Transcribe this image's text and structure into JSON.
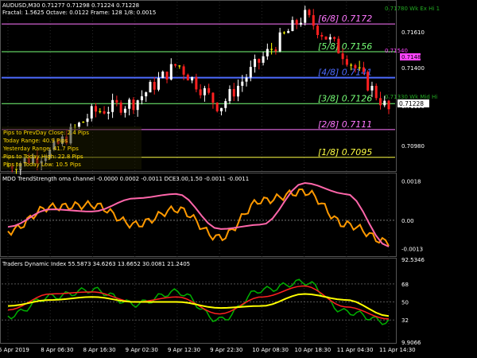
{
  "window_title": "AUDUSD,M30  0.71277 0.71298 0.71224 0.71228",
  "info_line": "Fractal: 1.5625   Octave: 0.0122   Frame: 128   1/8: 0.0015",
  "price_panel": {
    "y_ticks": [
      "0.71610",
      "0.71400",
      "0.71190",
      "0.70980"
    ],
    "current_price": "0.71228",
    "murrey_levels": [
      {
        "label": "[6/8]  0.7172",
        "value": 0.7172,
        "color": "#ff77ff"
      },
      {
        "label": "[5/8]  0.7156",
        "value": 0.7156,
        "color": "#77ff77"
      },
      {
        "label": "[4/8]  0.7141",
        "value": 0.7141,
        "color": "#4d6bff"
      },
      {
        "label": "[3/8]  0.7126",
        "value": 0.7126,
        "color": "#77ff77"
      },
      {
        "label": "[2/8]  0.7111",
        "value": 0.7111,
        "color": "#ff77ff"
      },
      {
        "label": "[1/8]  0.7095",
        "value": 0.7095,
        "color": "#ffff44"
      }
    ],
    "right_labels": [
      {
        "text": "0.71780  Wk Ex Hi 1",
        "color": "#22aa22"
      },
      {
        "text": "0.71540",
        "color": "#ff44ff"
      },
      {
        "text": "0.71480",
        "color": "#ff44ff"
      },
      {
        "text": "0.71330  Wk Mid Hi",
        "color": "#22aa22"
      }
    ],
    "overlay_text": [
      "Pips to PrevDay Close: 2.4 Pips",
      "Today Range: 40.9 Pips",
      "Yesterday Range: 41.7 Pips",
      "Pips to Today High: 22.8 Pips",
      "Pips to Today Low: 10.5 Pips"
    ]
  },
  "osc_panel": {
    "title": "MDO TrendStrength oma channel -0.0000 0.0002 -0.0011  DCE3.00,1.50 -0.0011 -0.0011",
    "y_ticks": [
      "0.0018",
      "0.00",
      "-0.0013"
    ]
  },
  "tdi_panel": {
    "title": "Traders Dynamic Index 55.5873 34.6263 13.6652 30.0081 21.2405",
    "y_ticks": [
      "92.5346",
      "68",
      "50",
      "32",
      "9.9066"
    ]
  },
  "colors": {
    "bull_candle": "#ffffff",
    "bear_candle": "#ff2020",
    "doji_candle": "#ffff00",
    "grid": "#2a2a2a",
    "osc_fast": "#ff9900",
    "osc_slow": "#ff66aa",
    "osc_green": "#00cc00",
    "osc_red": "#cc0000",
    "tdi_green": "#00b000",
    "tdi_red": "#ff2020",
    "tdi_yellow": "#ffff00",
    "tdi_blue": "#2040ff"
  },
  "chart_data": [
    {
      "type": "candlestick",
      "title": "AUDUSD,M30",
      "x": [
        "5 Apr 2019",
        "8 Apr 06:30",
        "8 Apr 16:30",
        "9 Apr 02:30",
        "9 Apr 12:30",
        "9 Apr 22:30",
        "10 Apr 08:30",
        "10 Apr 18:30",
        "11 Apr 04:30",
        "11 Apr 14:30"
      ],
      "ylim": [
        0.7088,
        0.7184
      ],
      "approx_close": [
        0.709,
        0.7098,
        0.7121,
        0.7127,
        0.7149,
        0.7124,
        0.7152,
        0.7177,
        0.7153,
        0.7122
      ],
      "legend": "none"
    },
    {
      "type": "line",
      "title": "MDO TrendStrength oma channel",
      "x": [
        "5 Apr 2019",
        "8 Apr 06:30",
        "8 Apr 16:30",
        "9 Apr 02:30",
        "9 Apr 12:30",
        "9 Apr 22:30",
        "10 Apr 08:30",
        "10 Apr 18:30",
        "11 Apr 04:30",
        "11 Apr 14:30"
      ],
      "ylim": [
        -0.0016,
        0.0021
      ],
      "series": [
        {
          "values": [
            -0.0005,
            0.0006,
            0.0007,
            -0.0002,
            0.0005,
            -0.0008,
            0.0009,
            0.0013,
            -0.0002,
            -0.001
          ]
        },
        {
          "values": [
            -0.0003,
            0.0005,
            0.0004,
            0.001,
            0.0012,
            -0.0004,
            -0.0002,
            0.0017,
            0.0012,
            -0.0012
          ]
        }
      ]
    },
    {
      "type": "line",
      "title": "Traders Dynamic Index",
      "x": [
        "5 Apr 2019",
        "8 Apr 06:30",
        "8 Apr 16:30",
        "9 Apr 02:30",
        "9 Apr 12:30",
        "9 Apr 22:30",
        "10 Apr 08:30",
        "10 Apr 18:30",
        "11 Apr 04:30",
        "11 Apr 14:30"
      ],
      "ylim": [
        9.9066,
        92.5346
      ],
      "series": [
        {
          "values": [
            36,
            55,
            62,
            48,
            60,
            32,
            62,
            70,
            40,
            30
          ]
        },
        {
          "values": [
            42,
            58,
            60,
            50,
            55,
            38,
            55,
            66,
            45,
            33
          ]
        },
        {
          "values": [
            46,
            52,
            55,
            50,
            50,
            44,
            46,
            58,
            52,
            36
          ]
        }
      ]
    }
  ]
}
